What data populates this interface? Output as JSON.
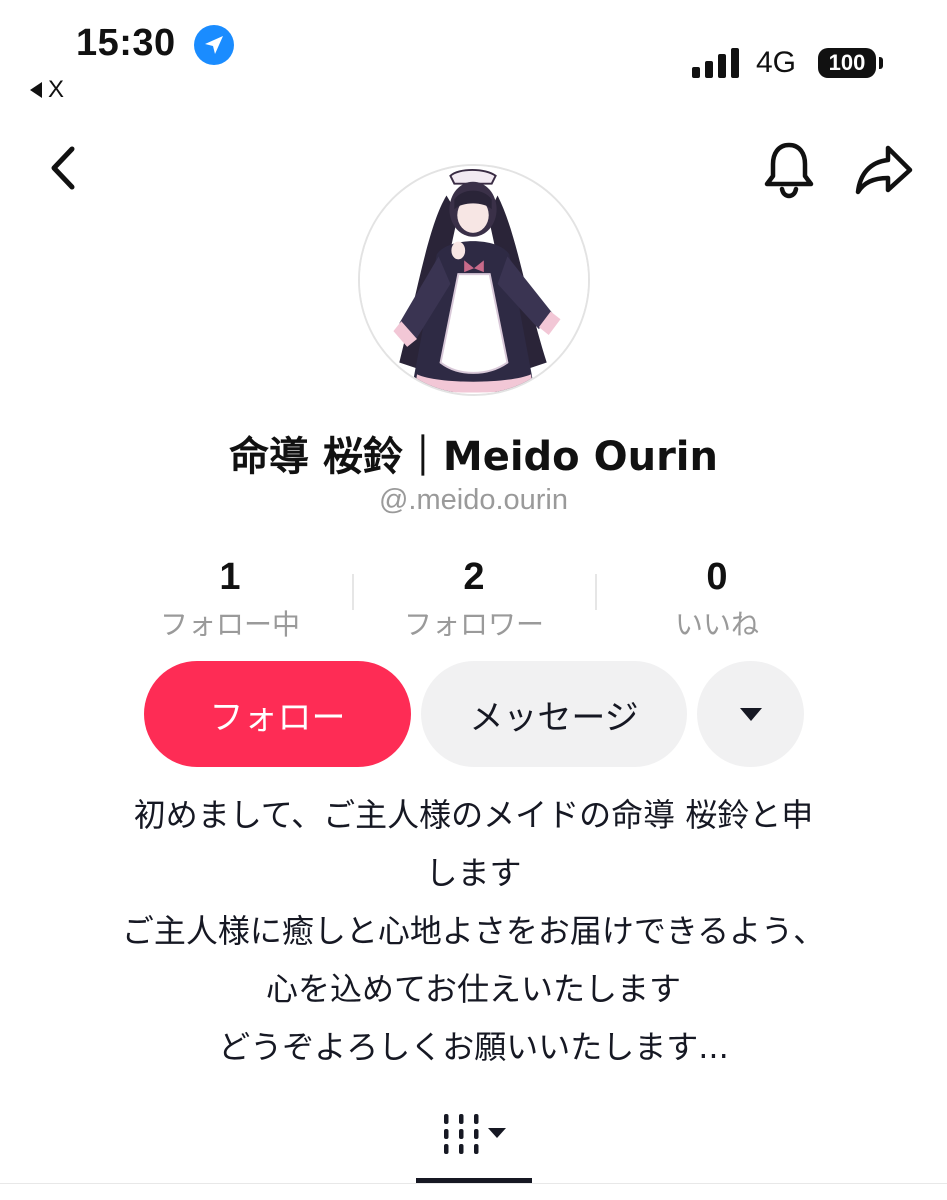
{
  "status_bar": {
    "time": "15:30",
    "back_app_label": "X",
    "network": "4G",
    "battery": "100"
  },
  "nav": {
    "back_icon": "chevron-left-icon",
    "bell_icon": "bell-icon",
    "share_icon": "share-arrow-icon"
  },
  "profile": {
    "display_name": "命導 桜鈴｜Meido Ourin",
    "username": "@.meido.ourin",
    "avatar_icon": "maid-character-avatar"
  },
  "stats": [
    {
      "value": "1",
      "label": "フォロー中"
    },
    {
      "value": "2",
      "label": "フォロワー"
    },
    {
      "value": "0",
      "label": "いいね"
    }
  ],
  "actions": {
    "follow_label": "フォロー",
    "message_label": "メッセージ",
    "more_icon": "caret-down-icon"
  },
  "bio": {
    "lines": [
      "初めまして、ご主人様のメイドの命導 桜鈴と申",
      "します",
      "ご主人様に癒しと心地よさをお届けできるよう、",
      "心を込めてお仕えいたします",
      "どうぞよろしくお願いいたします..."
    ]
  },
  "tabs": {
    "videos_icon": "videos-grid-icon"
  },
  "colors": {
    "follow_button": "#fe2c55",
    "secondary_button": "#f1f1f2",
    "muted_text": "#9a9a9a",
    "location_blue": "#1a8cff"
  }
}
